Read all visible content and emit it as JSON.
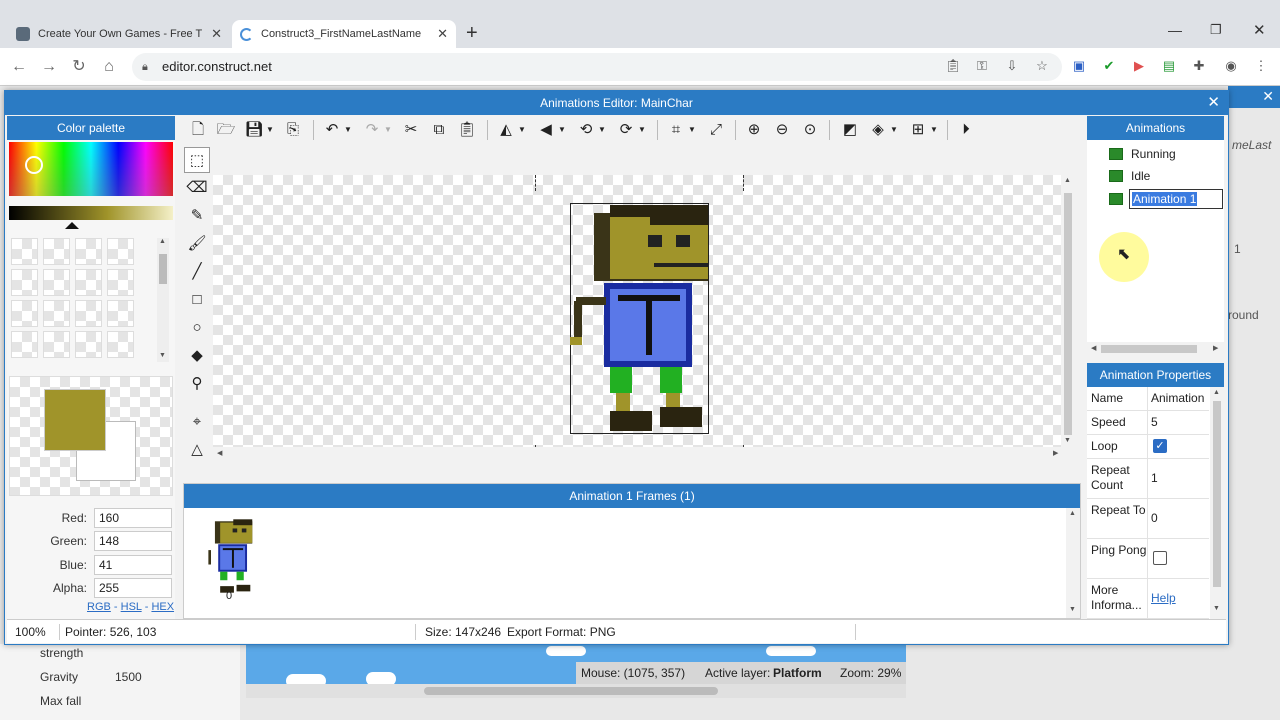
{
  "browser": {
    "tabs": [
      {
        "title": "Create Your Own Games - Free T",
        "active": false
      },
      {
        "title": "Construct3_FirstNameLastName",
        "active": true
      }
    ],
    "url": "editor.construct.net",
    "new_tab_label": "+"
  },
  "dialog": {
    "title": "Animations Editor: MainChar",
    "close_label": "✕"
  },
  "color_palette": {
    "title": "Color palette",
    "primary_color": "#a0942a",
    "secondary_color": "#ffffff",
    "fields": [
      {
        "label": "Red:",
        "value": "160"
      },
      {
        "label": "Green:",
        "value": "148"
      },
      {
        "label": "Blue:",
        "value": "41"
      },
      {
        "label": "Alpha:",
        "value": "255"
      }
    ],
    "modes": {
      "rgb": "RGB",
      "hsl": "HSL",
      "hex": "HEX",
      "sep": "-"
    }
  },
  "frames": {
    "title": "Animation 1 Frames (1)",
    "items": [
      {
        "index": "0"
      }
    ]
  },
  "animations": {
    "title": "Animations",
    "items": [
      {
        "name": "Running"
      },
      {
        "name": "Idle"
      },
      {
        "name": "Animation 1"
      }
    ]
  },
  "properties": {
    "title": "Animation Properties",
    "rows": [
      {
        "label": "Name",
        "value": "Animation"
      },
      {
        "label": "Speed",
        "value": "5"
      },
      {
        "label": "Loop",
        "value": ""
      },
      {
        "label": "Repeat Count",
        "value": "1"
      },
      {
        "label": "Repeat To",
        "value": "0"
      },
      {
        "label": "Ping Pong",
        "value": ""
      },
      {
        "label": "More Informa...",
        "value": "Help"
      }
    ]
  },
  "statusbar": {
    "zoom": "100%",
    "pointer": "Pointer: 526, 103",
    "size": "Size: 147x246",
    "export": "Export Format: PNG"
  },
  "background": {
    "prop_strength": "strength",
    "gravity_label": "Gravity",
    "gravity_value": "1500",
    "max_fall": "Max fall",
    "mouse": "Mouse: (1075, 357)",
    "active_layer_label": "Active layer:",
    "active_layer_value": "Platform",
    "zoom": "Zoom: 29%",
    "right_text_1": "meLast",
    "right_text_2": "1",
    "right_text_3": "round"
  }
}
